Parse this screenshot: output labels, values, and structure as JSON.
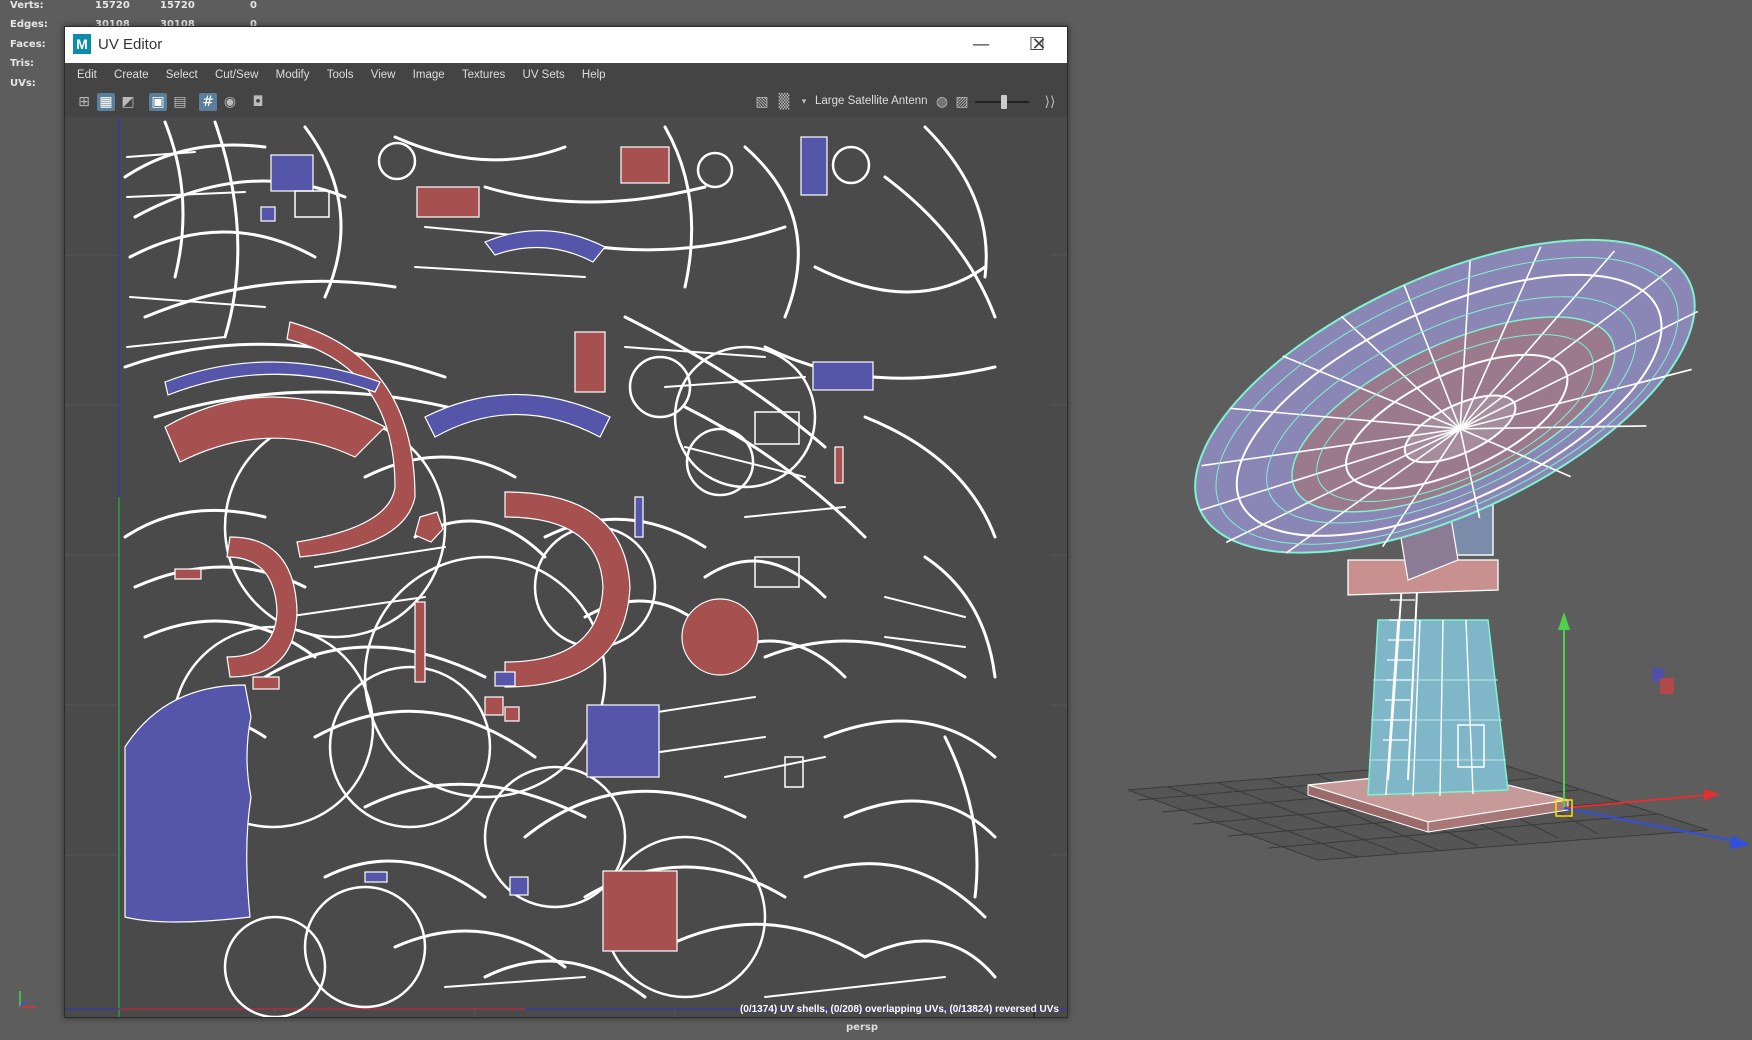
{
  "hud": {
    "rows": [
      {
        "label": "Verts:",
        "v1": "15720",
        "v2": "15720",
        "v3": "0"
      },
      {
        "label": "Edges:",
        "v1": "30108",
        "v2": "30108",
        "v3": "0"
      },
      {
        "label": "Faces:",
        "v1": "",
        "v2": "",
        "v3": ""
      },
      {
        "label": "Tris:",
        "v1": "",
        "v2": "",
        "v3": ""
      },
      {
        "label": "UVs:",
        "v1": "",
        "v2": "",
        "v3": ""
      }
    ]
  },
  "uv_editor": {
    "title": "UV Editor",
    "logo": "M",
    "controls": {
      "minimize": "—",
      "maximize": "☐",
      "close": "✕"
    },
    "menu": [
      "Edit",
      "Create",
      "Select",
      "Cut/Sew",
      "Modify",
      "Tools",
      "View",
      "Image",
      "Textures",
      "UV Sets",
      "Help"
    ],
    "toolbar": {
      "texture_name": "Large Satellite Antenn",
      "icons": [
        "grid-icon",
        "uv-shade-icon",
        "checker-icon",
        "frame-icon",
        "pixel-snap-icon",
        "grid-toggle-icon",
        "isolate-icon",
        "snapshot-icon"
      ]
    },
    "status": "(0/1374) UV shells, (0/208) overlapping UVs, (0/13824) reversed UVs"
  },
  "viewport": {
    "camera": "persp"
  },
  "colors": {
    "uv_red": "#a65050",
    "uv_blue": "#5555aa",
    "uv_line": "#ffffff",
    "wire_green": "#66ffcc",
    "bg": "#5d5d5d"
  }
}
